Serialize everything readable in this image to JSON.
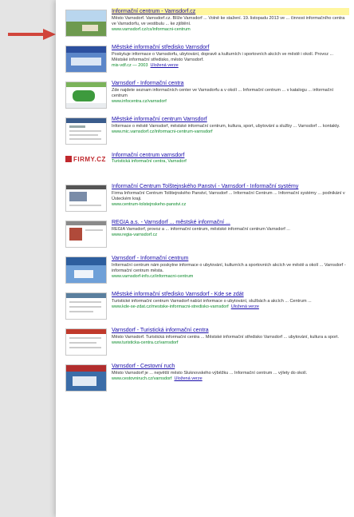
{
  "results": [
    {
      "title": "Informační centrum - Varnsdorf.cz",
      "snippet": "Město Varnsdorf. Varnsdorf.cz. Blíže Varnsdorf ... Volně ke stažení. 19. listopadu 2013 ve ... činnost informačního centra ve Varnsdorfu, ve vestibulu ... ke zjištění.",
      "url": "www.varnsdorf.cz/cs/informacni-centrum",
      "cached": "",
      "thumb": "landscape"
    },
    {
      "title": "Městské informační středisko Varnsdorf",
      "snippet": "Poskytuje informace o Varnsdorfu, ubytování, dopravě a kulturních i sportovních akcích ve městě i okolí. Provoz ... Městské informační středisko, město Varnsdorf.",
      "url": "mis-vdf.cz — 2003",
      "cached": "Uložená verze",
      "thumb": "blue"
    },
    {
      "title": "Varnsdorf - Informační centra",
      "snippet": "Zde najdete seznam informačních center ve Varnsdorfu a v okolí ... Informační centrum ... v katalogu ... informační centrum",
      "url": "www.infocentra.cz/varnsdorf",
      "cached": "",
      "thumb": "map"
    },
    {
      "title": "Městské informační centrum Varnsdorf",
      "snippet": "Informace o městě Varnsdorf, městské informační centrum, kultura, sport, ubytování a služby ... Varnsdorf ... kontakty.",
      "url": "www.mic.varnsdorf.cz/informacni-centrum-varnsdorf",
      "cached": "",
      "thumb": "doc"
    },
    {
      "title": "Informační centrum varnsdorf",
      "snippet": "",
      "url": "Turistická informační centra, Varnsdorf",
      "cached": "",
      "thumb": "logo",
      "logo_text": "FIRMY.CZ"
    },
    {
      "title": "Informační Centrum Tolštejnského Panství - Varnsdorf - Informační systémy",
      "snippet": "Firma Informační Centrum Tolštejnského Panství, Varnsdorf ... Informační Centrum ... Informační systémy ... podnikání v Ústeckém kraji.",
      "url": "www.centrum-tolstejnskeho-panstvi.cz",
      "cached": "",
      "thumb": "doc2"
    },
    {
      "title": "REGIA a.s. - Varnsdorf ... městské informační ...",
      "snippet": "REGIA Varnsdorf, provoz a ... informační centrum, městské informační centrum Varnsdorf ...",
      "url": "www.regia-varnsdorf.cz",
      "cached": "",
      "thumb": "doc3"
    },
    {
      "title": "Varnsdorf - Informační centrum",
      "snippet": "Informační centrum nám poskytne informace o ubytování, kulturních a sportovních akcích ve městě a okolí ... Varnsdorf - informační centrum města.",
      "url": "www.varnsdorf-info.cz/informacni-centrum",
      "cached": "",
      "thumb": "blue2"
    },
    {
      "title": "Městské informační středisko Varnsdorf - Kde se zdát",
      "snippet": "Turistické informační centrum Varnsdorf nabízí informace o ubytování, službách a akcích ... Centrum ...",
      "url": "www.kde-se-zdat.cz/mestske-informacni-stredisko-varnsdorf",
      "cached": "Uložená verze",
      "thumb": "doc4"
    },
    {
      "title": "Varnsdorf - Turistická informační centra",
      "snippet": "Město Varnsdorf. Turistická informační centra ... Městské informační středisko Varnsdorf ... ubytování, kultura a sport.",
      "url": "www.turisticka-centra.cz/varnsdorf",
      "cached": "",
      "thumb": "red"
    },
    {
      "title": "Varnsdorf - Cestovní ruch",
      "snippet": "Město Varnsdorf je ... největší město Šluknovského výběžku ... Informační centrum ... výlety do okolí.",
      "url": "www.cestovniruch.cz/varnsdorf",
      "cached": "Uložená verze",
      "thumb": "red2"
    }
  ]
}
